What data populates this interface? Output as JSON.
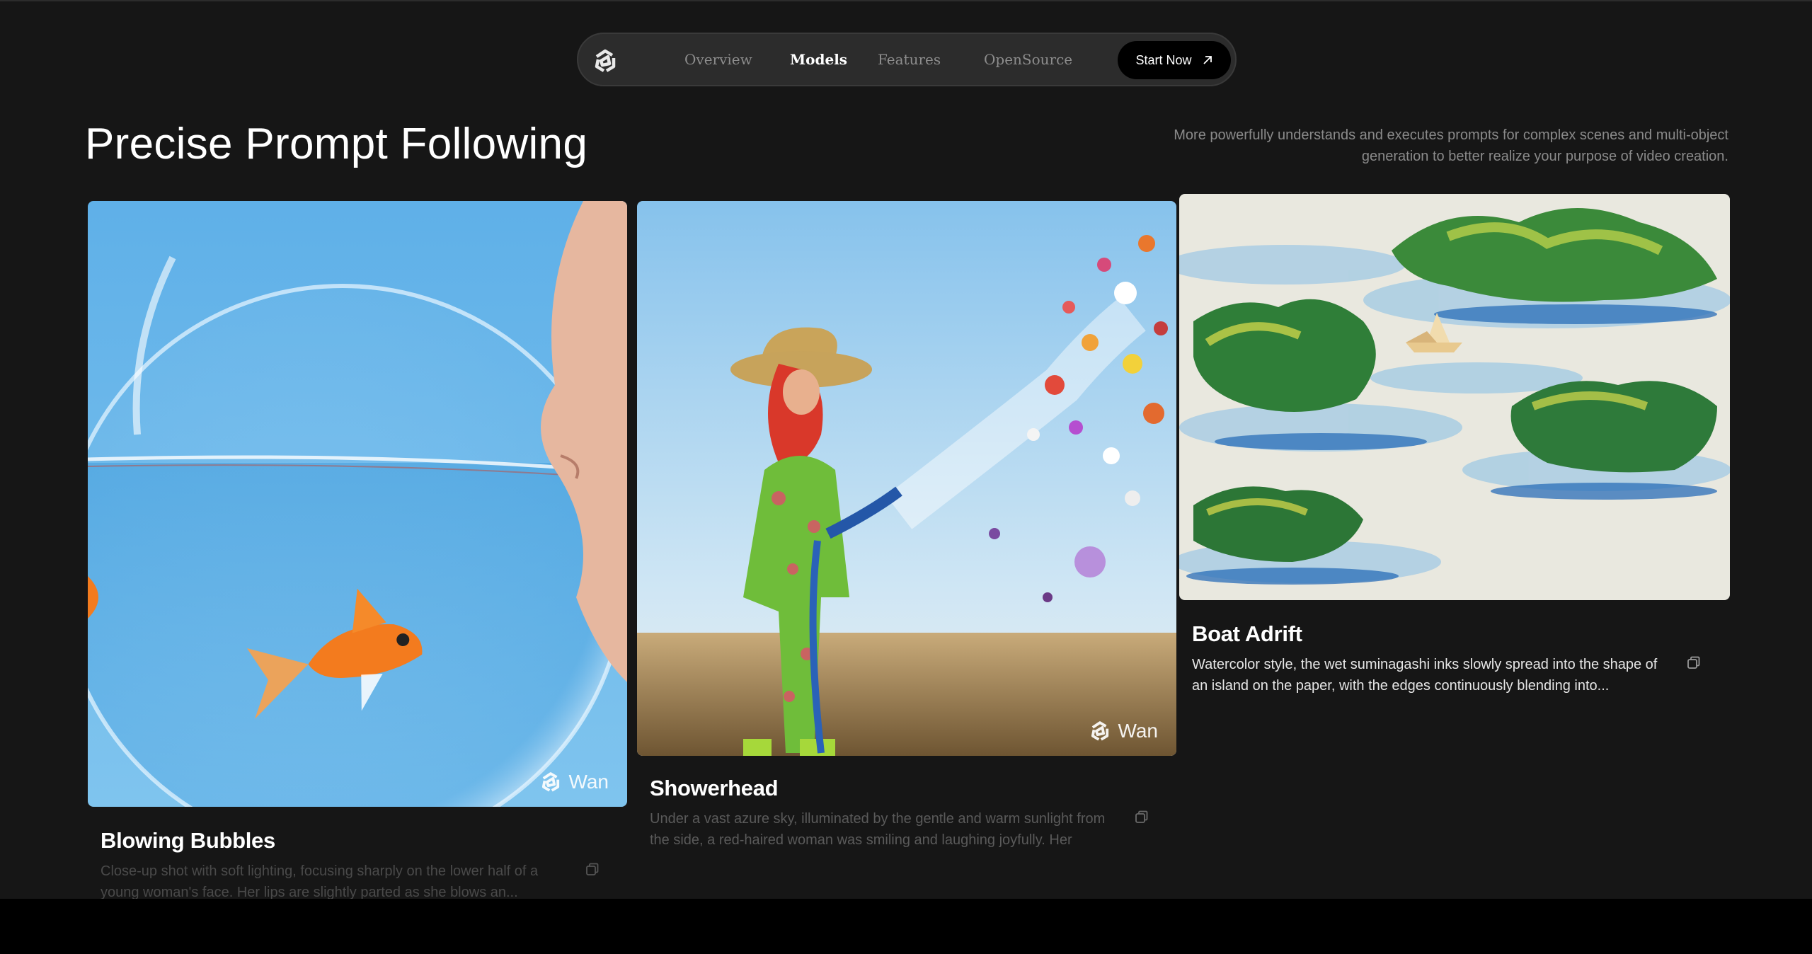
{
  "nav": {
    "logo_icon": "wan-logo-icon",
    "items": [
      {
        "label": "Overview",
        "active": false
      },
      {
        "label": "Models",
        "active": true
      },
      {
        "label": "Features",
        "active": false
      },
      {
        "label": "OpenSource",
        "active": false
      }
    ],
    "cta_label": "Start Now",
    "cta_icon": "arrow-up-right-icon"
  },
  "section": {
    "title": "Precise Prompt Following",
    "description": "More powerfully understands and executes prompts for complex scenes and multi-object generation to better realize your purpose of video creation."
  },
  "cards": [
    {
      "title": "Blowing Bubbles",
      "description": "Close-up shot with soft lighting, focusing sharply on the lower half of a young woman's face. Her lips are slightly parted as she blows an...",
      "watermark": "Wan",
      "description_color": "#4a4a4a"
    },
    {
      "title": "Showerhead",
      "description": "Under a vast azure sky, illuminated by the gentle and warm sunlight from the side, a red-haired woman was smiling and laughing joyfully. Her long,...",
      "watermark": "Wan",
      "description_color": "#5a5a5a"
    },
    {
      "title": "Boat Adrift",
      "description": "Watercolor style, the wet suminagashi inks slowly spread into the shape of an island on the paper, with the edges continuously blending into...",
      "description_color": "#e6e6e6"
    }
  ],
  "colors": {
    "background": "#161616",
    "nav_background": "#2c2c2c",
    "cta_background": "#000000"
  }
}
